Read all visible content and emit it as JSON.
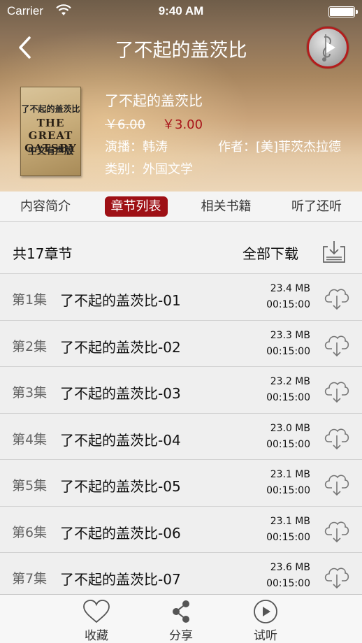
{
  "status_bar": {
    "carrier": "Carrier",
    "time": "9:40 AM"
  },
  "nav": {
    "title": "了不起的盖茨比",
    "back_icon": "chevron-left-icon",
    "player_icon": "music-note-play-icon"
  },
  "book": {
    "cover_line1": "了不起的盖茨比",
    "cover_line2": "THE GREAT",
    "cover_line3": "GATSBY",
    "cover_line4": "中文有声版",
    "title": "了不起的盖茨比",
    "old_price": "￥6.00",
    "new_price": "￥3.00",
    "narrator": "演播：韩涛",
    "author": "作者：[美]菲茨杰拉德",
    "category": "类别：外国文学"
  },
  "tabs": [
    {
      "label": "内容简介",
      "active": false
    },
    {
      "label": "章节列表",
      "active": true
    },
    {
      "label": "相关书籍",
      "active": false
    },
    {
      "label": "听了还听",
      "active": false
    }
  ],
  "summary": {
    "count": "共17章节",
    "download_all": "全部下载"
  },
  "chapters": [
    {
      "ep": "第1集",
      "name": "了不起的盖茨比-01",
      "size": "23.4 MB",
      "duration": "00:15:00"
    },
    {
      "ep": "第2集",
      "name": "了不起的盖茨比-02",
      "size": "23.3 MB",
      "duration": "00:15:00"
    },
    {
      "ep": "第3集",
      "name": "了不起的盖茨比-03",
      "size": "23.2 MB",
      "duration": "00:15:00"
    },
    {
      "ep": "第4集",
      "name": "了不起的盖茨比-04",
      "size": "23.0 MB",
      "duration": "00:15:00"
    },
    {
      "ep": "第5集",
      "name": "了不起的盖茨比-05",
      "size": "23.1 MB",
      "duration": "00:15:00"
    },
    {
      "ep": "第6集",
      "name": "了不起的盖茨比-06",
      "size": "23.1 MB",
      "duration": "00:15:00"
    },
    {
      "ep": "第7集",
      "name": "了不起的盖茨比-07",
      "size": "23.6 MB",
      "duration": "00:15:00"
    }
  ],
  "bottom_bar": [
    {
      "label": "收藏",
      "icon": "heart-icon"
    },
    {
      "label": "分享",
      "icon": "share-icon"
    },
    {
      "label": "试听",
      "icon": "play-circle-icon"
    }
  ],
  "colors": {
    "accent": "#9e1015",
    "price": "#a8141a",
    "header_brown": "#8a7158"
  }
}
